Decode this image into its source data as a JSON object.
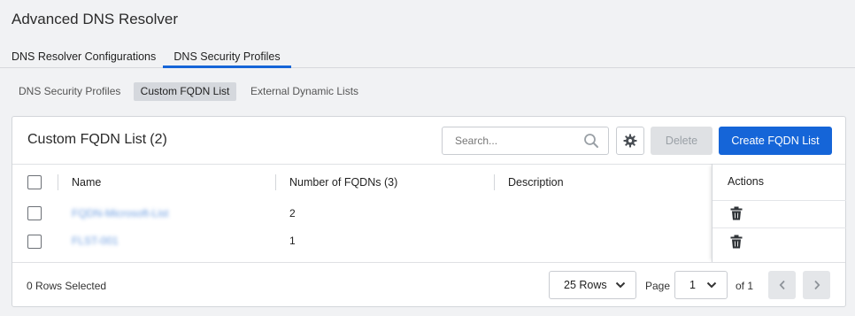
{
  "page": {
    "title": "Advanced DNS Resolver"
  },
  "main_tabs": [
    {
      "label": "DNS Resolver Configurations",
      "active": false
    },
    {
      "label": "DNS Security Profiles",
      "active": true
    }
  ],
  "sub_tabs": [
    {
      "label": "DNS Security Profiles",
      "active": false
    },
    {
      "label": "Custom FQDN List",
      "active": true
    },
    {
      "label": "External Dynamic Lists",
      "active": false
    }
  ],
  "card": {
    "title": "Custom FQDN List",
    "count": "(2)",
    "search_placeholder": "Search...",
    "delete_label": "Delete",
    "create_label": "Create FQDN List"
  },
  "table": {
    "columns": [
      "Name",
      "Number of FQDNs (3)",
      "Description",
      "Actions"
    ],
    "rows": [
      {
        "name": "FQDN-Microsoft-List",
        "count": "2",
        "description": ""
      },
      {
        "name": "FLST-001",
        "count": "1",
        "description": ""
      }
    ]
  },
  "footer": {
    "rows_selected": "0 Rows Selected",
    "rows_per_page": "25 Rows",
    "page_label": "Page",
    "page_value": "1",
    "of_label": "of 1"
  },
  "colors": {
    "accent": "#1565d8",
    "link": "#3a7bd5"
  },
  "icons": [
    "search-icon",
    "gear-icon",
    "trash-icon",
    "chevron-down-icon",
    "chevron-left-icon",
    "chevron-right-icon"
  ]
}
